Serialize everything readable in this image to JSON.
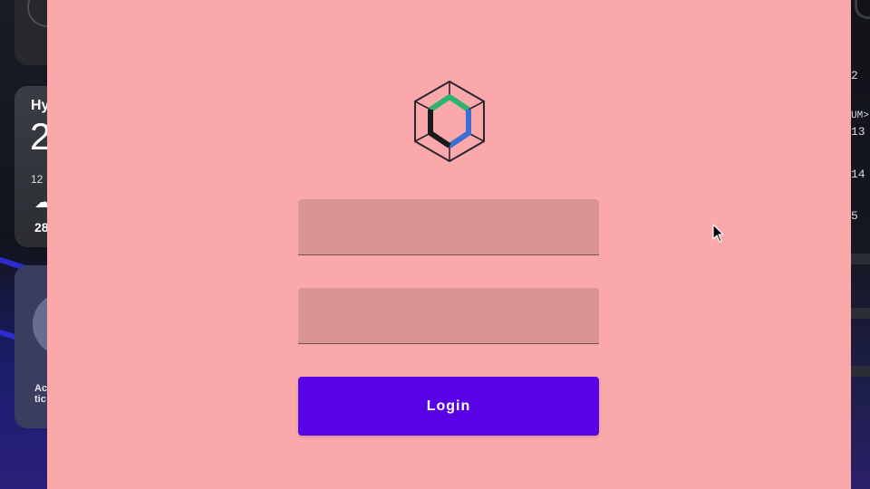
{
  "desktop": {
    "weather_widget": {
      "city": "Hy",
      "temperature": "2",
      "detail": "12",
      "low": "28"
    },
    "bottom_widget": {
      "text_line1": "Ac",
      "text_line2": "tic"
    },
    "right_panel": {
      "lines": [
        "2",
        "UM>",
        "13",
        "14",
        "5"
      ]
    }
  },
  "login_form": {
    "logo": "jmix-hexagon-logo",
    "username": {
      "value": "",
      "placeholder": ""
    },
    "password": {
      "value": "",
      "placeholder": ""
    },
    "login_label": "Login"
  },
  "colors": {
    "window_background": "#fba8aa",
    "field_background": "#d89591",
    "button_background": "#5703e6",
    "button_text": "#ffffff"
  }
}
